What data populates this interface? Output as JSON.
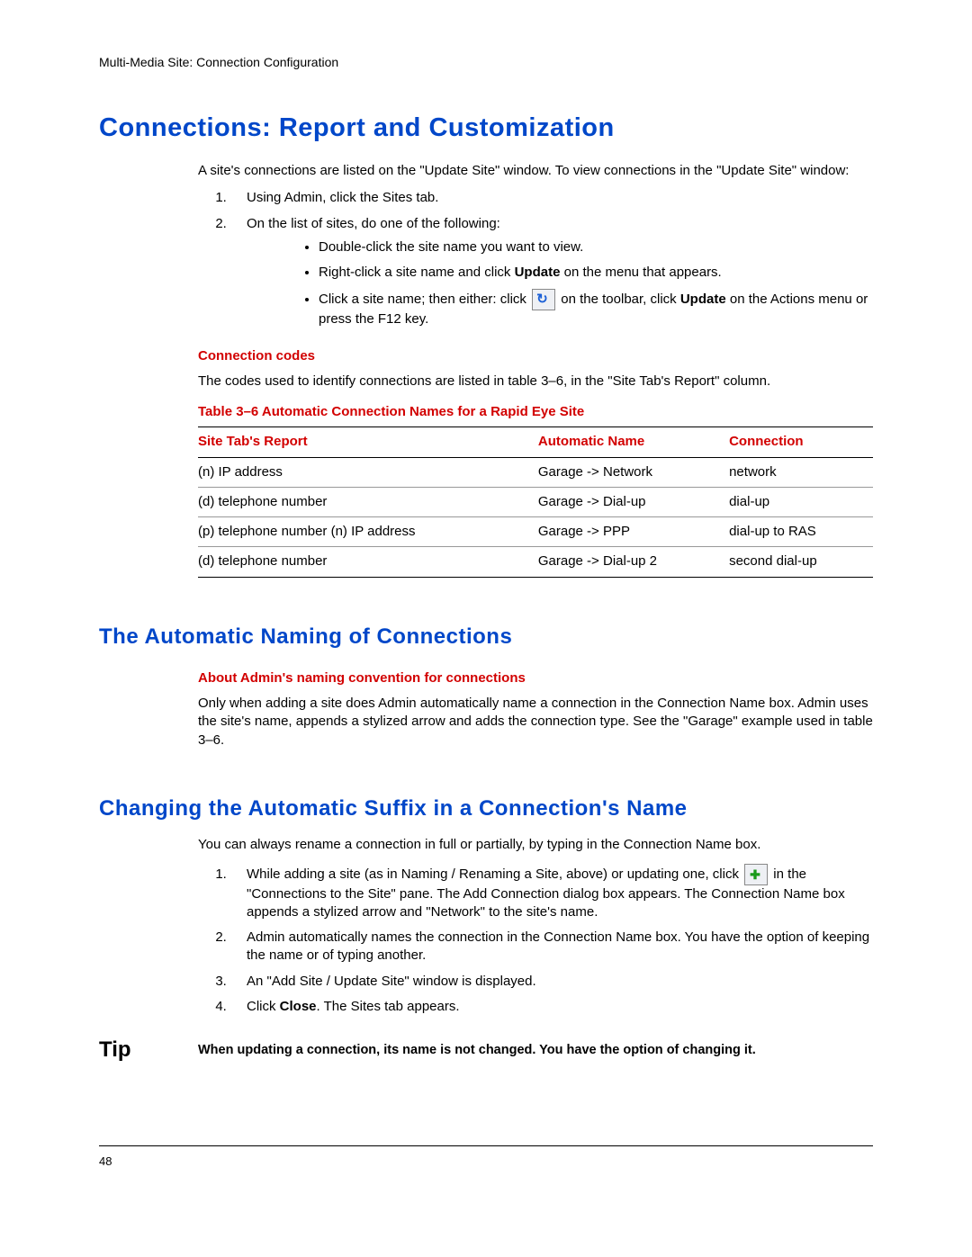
{
  "header": "Multi-Media Site: Connection Configuration",
  "h1": "Connections: Report and Customization",
  "intro": "A site's connections are listed on the \"Update Site\" window. To view connections in the \"Update Site\" window:",
  "step1": "Using Admin, click the Sites tab.",
  "step2": "On the list of sites, do one of the following:",
  "bullet1": "Double-click the site name you want to view.",
  "bullet2a": "Right-click a site name and click ",
  "bullet2b": "Update",
  "bullet2c": " on the menu that appears.",
  "bullet3a": "Click a site name; then either: click ",
  "bullet3b": " on the toolbar, click ",
  "bullet3c": "Update",
  "bullet3d": " on the Actions menu or press the F12 key.",
  "sub_codes": "Connection codes",
  "codes_p": "The codes used to identify connections are listed in table 3–6, in the \"Site Tab's Report\" column.",
  "table": {
    "caption": "Table 3–6   Automatic Connection Names for a Rapid Eye Site",
    "h1": "Site Tab's Report",
    "h2": "Automatic Name",
    "h3": "Connection",
    "rows": [
      {
        "c1": "(n) IP address",
        "c2": "Garage -> Network",
        "c3": "network"
      },
      {
        "c1": "(d) telephone number",
        "c2": "Garage -> Dial-up",
        "c3": "dial-up"
      },
      {
        "c1": "(p) telephone number (n) IP address",
        "c2": "Garage -> PPP",
        "c3": "dial-up to RAS"
      },
      {
        "c1": "(d) telephone number",
        "c2": "Garage -> Dial-up 2",
        "c3": "second dial-up"
      }
    ]
  },
  "h2a": "The Automatic Naming of Connections",
  "sub_about": "About Admin's naming convention for connections",
  "about_p": "Only when adding a site does Admin automatically name a connection in the Connection Name box. Admin uses the site's name, appends a stylized arrow and adds the connection type. See the \"Garage\" example used in table 3–6.",
  "h2b": "Changing the Automatic Suffix in a Connection's Name",
  "change_p": "You can always rename a connection in full or partially, by typing in the Connection Name box.",
  "cstep1a": "While adding a site (as in Naming / Renaming a Site, above) or updating one, click ",
  "cstep1b": " in the \"Connections to the Site\" pane. The Add Connection dialog box appears. The Connection Name box appends a stylized arrow and \"Network\" to the site's name.",
  "cstep2": "Admin automatically names the connection in the Connection Name box. You have the option of keeping the name or of typing another.",
  "cstep3": "An \"Add Site / Update Site\" window is displayed.",
  "cstep4a": "Click ",
  "cstep4b": "Close",
  "cstep4c": ". The Sites tab appears.",
  "tip_label": "Tip",
  "tip_text": "When updating a connection, its name is not changed. You have the option of changing it.",
  "page_no": "48"
}
